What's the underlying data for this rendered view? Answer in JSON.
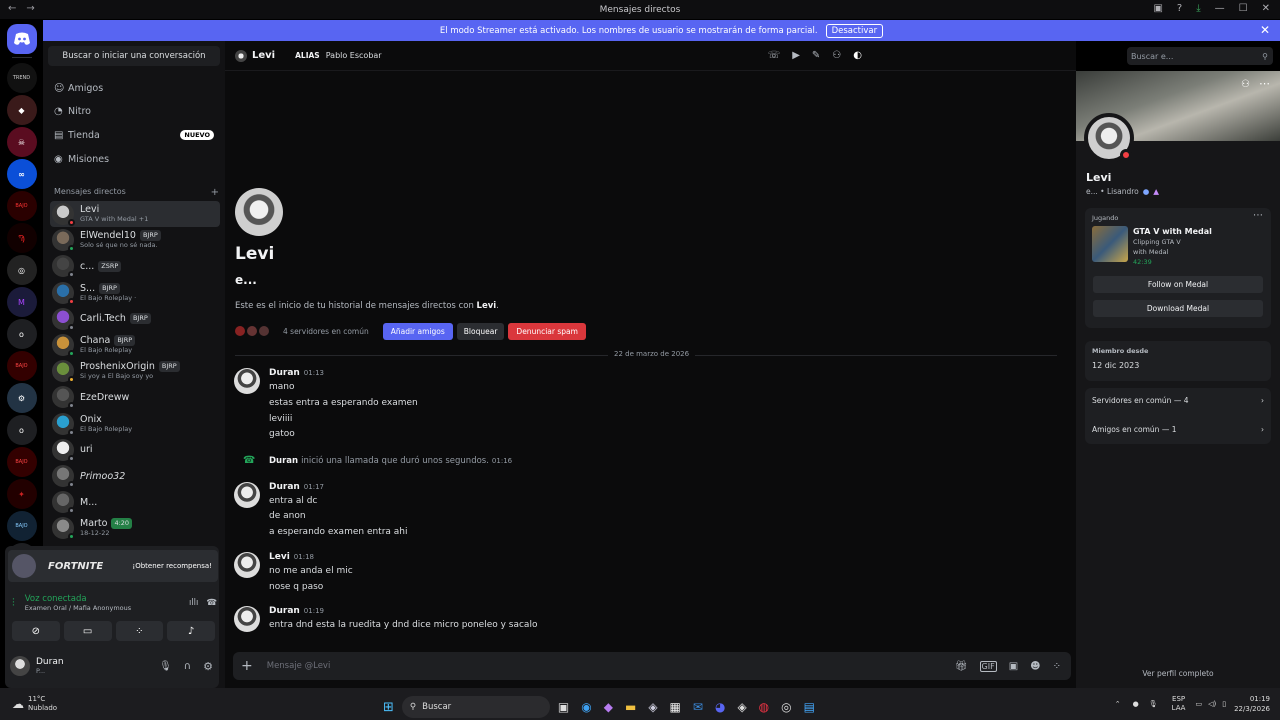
{
  "window": {
    "title": "Mensajes directos"
  },
  "banner": {
    "text": "El modo Streamer está activado. Los nombres de usuario se mostrarán de forma parcial.",
    "button": "Desactivar"
  },
  "dm_search": {
    "placeholder": "Buscar o iniciar una conversación"
  },
  "nav": [
    {
      "label": "Amigos",
      "icon": "friends-icon"
    },
    {
      "label": "Nitro",
      "icon": "nitro-icon"
    },
    {
      "label": "Tienda",
      "icon": "shop-icon",
      "badge": "NUEVO"
    },
    {
      "label": "Misiones",
      "icon": "quests-icon"
    }
  ],
  "dm_header": "Mensajes directos",
  "dms": [
    {
      "name": "Levi",
      "sub": "GTA V with Medal +1",
      "tag": "",
      "active": true
    },
    {
      "name": "ElWendel10",
      "sub": "Solo sé que no sé nada.",
      "tag": "BJRP"
    },
    {
      "name": "c...",
      "sub": "",
      "tag": "ZSRP"
    },
    {
      "name": "S...",
      "sub": "El Bajo Roleplay ·",
      "tag": "BJRP"
    },
    {
      "name": "Carli.Tech",
      "sub": "",
      "tag": "BJRP"
    },
    {
      "name": "Chana",
      "sub": "El Bajo Roleplay",
      "tag": "BJRP"
    },
    {
      "name": "ProshenixOrigin",
      "sub": "Si yoy a El Bajo soy yo",
      "tag": "BJRP"
    },
    {
      "name": "EzeDreww",
      "sub": "",
      "tag": ""
    },
    {
      "name": "Onix",
      "sub": "El Bajo Roleplay",
      "tag": ""
    },
    {
      "name": "uri",
      "sub": "",
      "tag": ""
    },
    {
      "name": "Primoo32",
      "sub": "",
      "tag": ""
    },
    {
      "name": "M...",
      "sub": "",
      "tag": ""
    },
    {
      "name": "Marto",
      "sub": "18-12-22",
      "tag": "4:20"
    }
  ],
  "promo": {
    "game": "FORTNITE",
    "button": "¡Obtener recompensa!"
  },
  "voice": {
    "status": "Voz conectada",
    "channel": "Examen Oral / Mafia Anonymous"
  },
  "user": {
    "name": "Duran",
    "status": "P..."
  },
  "chat_header": {
    "name": "Levi",
    "alias_label": "ALIAS",
    "alias": "Pablo Escobar"
  },
  "search_top": {
    "placeholder": "Buscar e..."
  },
  "intro": {
    "name": "Levi",
    "subtitle": "e...",
    "text_prefix": "Este es el inicio de tu historial de mensajes directos con ",
    "text_name": "Levi",
    "text_suffix": ".",
    "servers": "4 servidores en común",
    "add_btn": "Añadir amigos",
    "block_btn": "Bloquear",
    "spam_btn": "Denunciar spam"
  },
  "date_divider": "22 de marzo de 2026",
  "messages": [
    {
      "author": "Duran",
      "time": "01:13",
      "lines": [
        "mano",
        "estas entra a esperando examen",
        "leviiii",
        "gatoo"
      ]
    },
    {
      "author": "Duran",
      "time": "01:17",
      "lines": [
        "entra al dc",
        "de anon",
        "a esperando examen entra ahi"
      ]
    },
    {
      "author": "Levi",
      "time": "01:18",
      "lines": [
        "no me anda el mic",
        "nose q paso"
      ]
    },
    {
      "author": "Duran",
      "time": "01:19",
      "lines": [
        "entra dnd esta la ruedita y dnd dice micro poneleo y sacalo"
      ]
    }
  ],
  "call": {
    "author": "Duran",
    "text": "inició una llamada que duró unos segundos.",
    "time": "01:16"
  },
  "composer": {
    "placeholder": "Mensaje @Levi"
  },
  "profile": {
    "name": "Levi",
    "sub": "e... • Lisandro",
    "activity_label": "Jugando",
    "game": "GTA V with Medal",
    "game_sub1": "Clipping GTA V",
    "game_sub2": "with Medal",
    "elapsed": "42:39",
    "follow_btn": "Follow on Medal",
    "download_btn": "Download Medal",
    "member_label": "Miembro desde",
    "member_date": "12 dic 2023",
    "servers_common": "Servidores en común — 4",
    "friends_common": "Amigos en común — 1",
    "view_full": "Ver perfil completo"
  },
  "taskbar": {
    "temp": "11°C",
    "weather": "Nublado",
    "search": "Buscar",
    "lang1": "ESP",
    "lang2": "LAA",
    "time": "01:19",
    "date": "22/3/2026"
  }
}
